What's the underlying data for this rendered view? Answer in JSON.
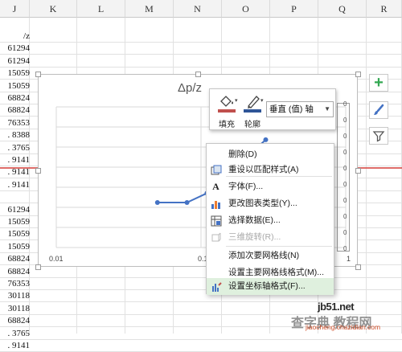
{
  "columns": [
    "J",
    "K",
    "L",
    "M",
    "N",
    "O",
    "P",
    "Q",
    "R"
  ],
  "cells": [
    "/z",
    "61294",
    "61294",
    "15059",
    "15059",
    "68824",
    "68824",
    "76353",
    ". 8388",
    ". 3765",
    ". 9141",
    ". 9141",
    ". 9141",
    "",
    "61294",
    "15059",
    "15059",
    "15059",
    "68824",
    "68824",
    "76353",
    "30118",
    "30118",
    "68824",
    ". 3765",
    ". 9141"
  ],
  "chart": {
    "title": "Δp/z",
    "x_labels": [
      "0.01",
      "0.1",
      "1"
    ],
    "right_ticks": [
      "0",
      "0",
      "0",
      "0",
      "0",
      "0",
      "0",
      "0",
      "0",
      "0"
    ]
  },
  "chart_data": {
    "type": "line",
    "title": "Δp/z",
    "xlabel": "",
    "ylabel": "",
    "x_scale": "log",
    "x_tick_labels": [
      "0.01",
      "0.1",
      "1"
    ],
    "series": [
      {
        "x": [
          0.05,
          0.08,
          0.11,
          0.28
        ],
        "y": [
          0.48,
          0.48,
          0.58,
          1.15
        ]
      }
    ]
  },
  "side_buttons": {
    "add": "plus-icon",
    "style": "brush-icon",
    "filter": "filter-icon"
  },
  "mini_toolbar": {
    "fill_label": "填充",
    "outline_label": "轮廓",
    "selector_value": "垂直 (值) 轴"
  },
  "context_menu": {
    "items": [
      {
        "label": "删除(D)",
        "icon": "",
        "disabled": false,
        "highlight": false
      },
      {
        "label": "重设以匹配样式(A)",
        "icon": "reset-style-icon",
        "disabled": false,
        "highlight": false
      },
      {
        "label": "字体(F)...",
        "icon": "font-icon",
        "disabled": false,
        "highlight": false
      },
      {
        "label": "更改图表类型(Y)...",
        "icon": "chart-type-icon",
        "disabled": false,
        "highlight": false
      },
      {
        "label": "选择数据(E)...",
        "icon": "select-data-icon",
        "disabled": false,
        "highlight": false
      },
      {
        "label": "三维旋转(R)...",
        "icon": "3d-rotate-icon",
        "disabled": true,
        "highlight": false
      },
      {
        "label": "添加次要网格线(N)",
        "icon": "",
        "disabled": false,
        "highlight": false
      },
      {
        "label": "设置主要网格线格式(M)...",
        "icon": "",
        "disabled": false,
        "highlight": false
      },
      {
        "label": "设置坐标轴格式(F)...",
        "icon": "format-axis-icon",
        "disabled": false,
        "highlight": true
      }
    ]
  },
  "watermark": {
    "line1": "jb51.net",
    "line2": "查字典 教程网",
    "line3": "jiaocheng.chazidian.com"
  },
  "colors": {
    "accent_green": "#33a852",
    "series_blue": "#4472c4",
    "red_line": "#d9534f",
    "fill_red": "#c0504d",
    "outline_blue": "#2f5597"
  }
}
